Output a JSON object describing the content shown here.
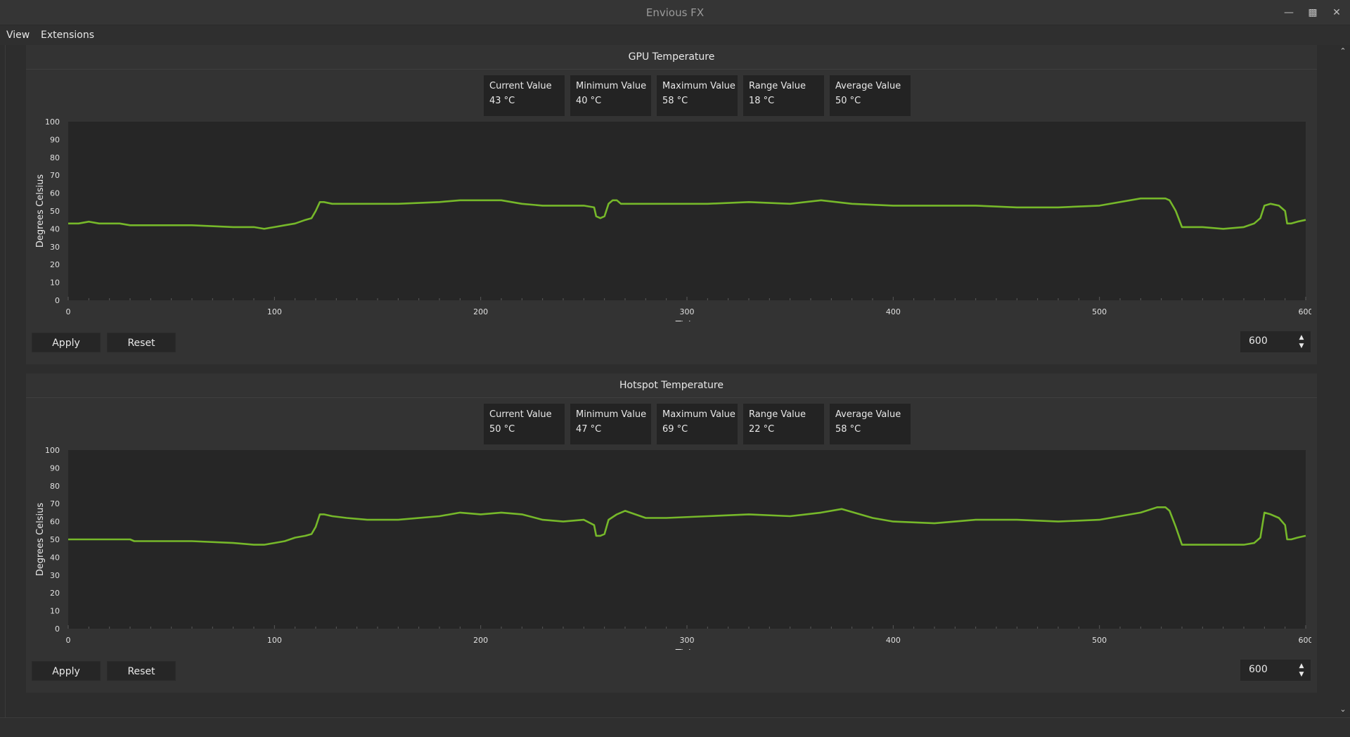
{
  "window": {
    "title": "Envious FX"
  },
  "menu": {
    "items": [
      "View",
      "Extensions"
    ]
  },
  "panels": [
    {
      "title": "GPU Temperature",
      "stats": [
        {
          "label": "Current Value",
          "value": "43 °C"
        },
        {
          "label": "Minimum Value",
          "value": "40 °C"
        },
        {
          "label": "Maximum Value",
          "value": "58 °C"
        },
        {
          "label": "Range Value",
          "value": "18 °C"
        },
        {
          "label": "Average Value",
          "value": "50 °C"
        }
      ],
      "apply_label": "Apply",
      "reset_label": "Reset",
      "spin_value": "600"
    },
    {
      "title": "Hotspot Temperature",
      "stats": [
        {
          "label": "Current Value",
          "value": "50 °C"
        },
        {
          "label": "Minimum Value",
          "value": "47 °C"
        },
        {
          "label": "Maximum Value",
          "value": "69 °C"
        },
        {
          "label": "Range Value",
          "value": "22 °C"
        },
        {
          "label": "Average Value",
          "value": "58 °C"
        }
      ],
      "apply_label": "Apply",
      "reset_label": "Reset",
      "spin_value": "600"
    }
  ],
  "chart_data": [
    {
      "type": "line",
      "xlabel": "Ticks",
      "ylabel": "Degrees Celsius",
      "xlim": [
        0,
        600
      ],
      "ylim": [
        0,
        100
      ],
      "xticks": [
        "0",
        "100",
        "200",
        "300",
        "400",
        "500",
        "600"
      ],
      "yticks": [
        "0",
        "10",
        "20",
        "30",
        "40",
        "50",
        "60",
        "70",
        "80",
        "90",
        "100"
      ],
      "line_color": "#76b82a",
      "series": [
        {
          "x": [
            0,
            5,
            10,
            15,
            20,
            25,
            30,
            40,
            60,
            80,
            90,
            95,
            100,
            105,
            110,
            115,
            118,
            120,
            122,
            124,
            128,
            135,
            145,
            160,
            180,
            190,
            200,
            210,
            220,
            230,
            240,
            250,
            255,
            256,
            258,
            260,
            262,
            264,
            266,
            268,
            275,
            290,
            310,
            330,
            350,
            365,
            380,
            400,
            420,
            440,
            460,
            480,
            500,
            520,
            528,
            532,
            534,
            536,
            537,
            540,
            550,
            560,
            570,
            575,
            578,
            580,
            583,
            587,
            590,
            591,
            593,
            596,
            600
          ],
          "y": [
            43,
            43,
            44,
            43,
            43,
            43,
            42,
            42,
            42,
            41,
            41,
            40,
            41,
            42,
            43,
            45,
            46,
            50,
            55,
            55,
            54,
            54,
            54,
            54,
            55,
            56,
            56,
            56,
            54,
            53,
            53,
            53,
            52,
            47,
            46,
            47,
            54,
            56,
            56,
            54,
            54,
            54,
            54,
            55,
            54,
            56,
            54,
            53,
            53,
            53,
            52,
            52,
            53,
            57,
            57,
            57,
            56,
            52,
            50,
            41,
            41,
            40,
            41,
            43,
            46,
            53,
            54,
            53,
            50,
            43,
            43,
            44,
            45
          ]
        }
      ]
    },
    {
      "type": "line",
      "xlabel": "Ticks",
      "ylabel": "Degrees Celsius",
      "xlim": [
        0,
        600
      ],
      "ylim": [
        0,
        100
      ],
      "xticks": [
        "0",
        "100",
        "200",
        "300",
        "400",
        "500",
        "600"
      ],
      "yticks": [
        "0",
        "10",
        "20",
        "30",
        "40",
        "50",
        "60",
        "70",
        "80",
        "90",
        "100"
      ],
      "line_color": "#76b82a",
      "series": [
        {
          "x": [
            0,
            10,
            20,
            30,
            32,
            40,
            60,
            80,
            90,
            95,
            100,
            105,
            110,
            115,
            118,
            120,
            122,
            124,
            128,
            135,
            145,
            160,
            180,
            190,
            200,
            210,
            220,
            230,
            240,
            250,
            255,
            256,
            258,
            260,
            262,
            266,
            270,
            280,
            290,
            310,
            330,
            350,
            365,
            375,
            390,
            400,
            420,
            440,
            460,
            480,
            500,
            520,
            528,
            532,
            534,
            536,
            537,
            540,
            550,
            560,
            570,
            575,
            578,
            580,
            583,
            587,
            590,
            591,
            593,
            596,
            600
          ],
          "y": [
            50,
            50,
            50,
            50,
            49,
            49,
            49,
            48,
            47,
            47,
            48,
            49,
            51,
            52,
            53,
            57,
            64,
            64,
            63,
            62,
            61,
            61,
            63,
            65,
            64,
            65,
            64,
            61,
            60,
            61,
            58,
            52,
            52,
            53,
            61,
            64,
            66,
            62,
            62,
            63,
            64,
            63,
            65,
            67,
            62,
            60,
            59,
            61,
            61,
            60,
            61,
            65,
            68,
            68,
            66,
            60,
            57,
            47,
            47,
            47,
            47,
            48,
            51,
            65,
            64,
            62,
            58,
            50,
            50,
            51,
            52
          ]
        }
      ]
    }
  ]
}
